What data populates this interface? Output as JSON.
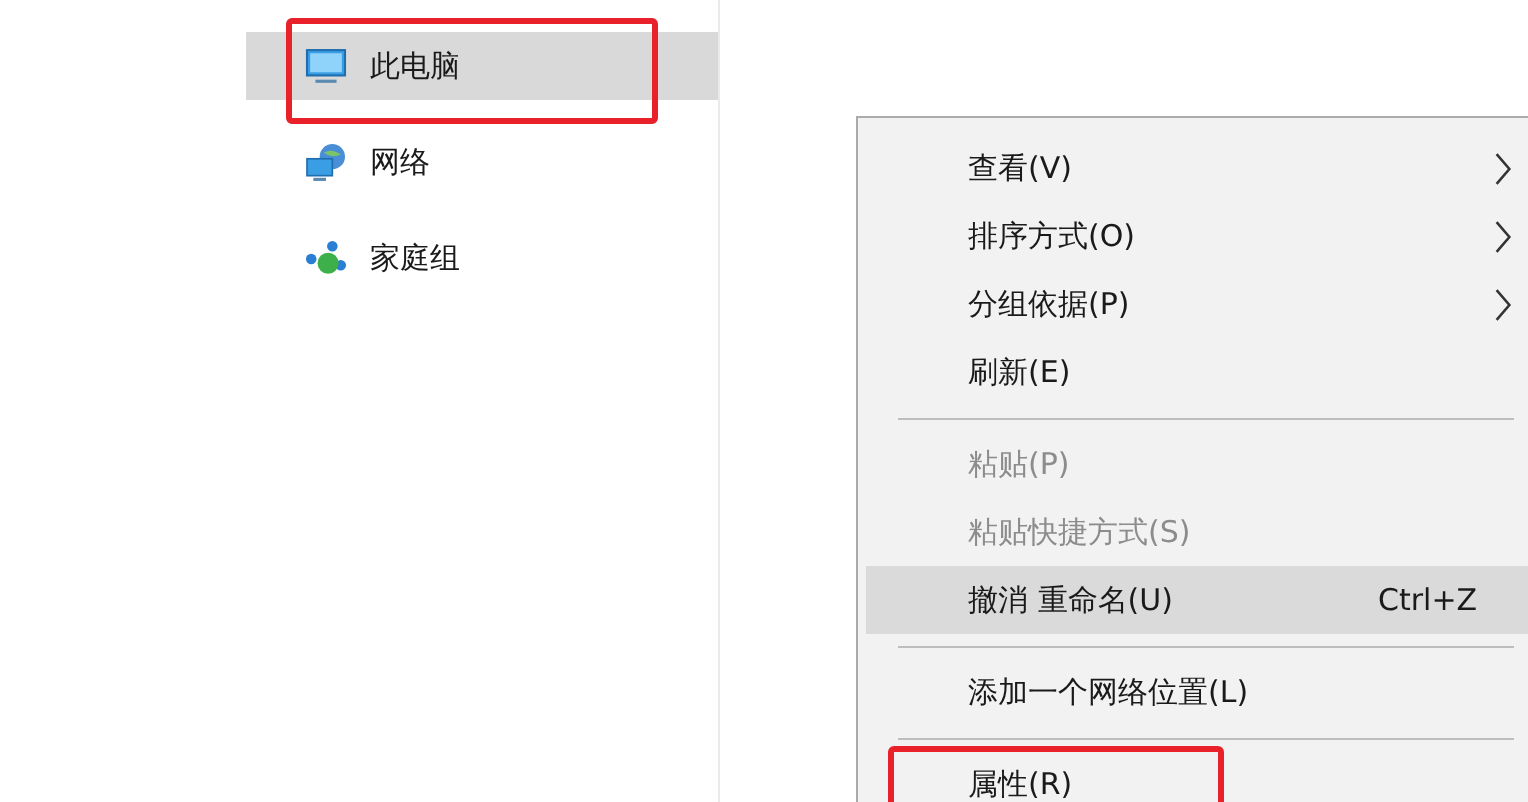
{
  "nav": {
    "items": [
      {
        "label": "此电脑",
        "selected": true,
        "annotated": true
      },
      {
        "label": "网络",
        "selected": false,
        "annotated": false
      },
      {
        "label": "家庭组",
        "selected": false,
        "annotated": false
      }
    ]
  },
  "context_menu": {
    "items": [
      {
        "kind": "item",
        "label": "查看(V)",
        "submenu": true,
        "disabled": false,
        "selected": false,
        "annotated": false
      },
      {
        "kind": "item",
        "label": "排序方式(O)",
        "submenu": true,
        "disabled": false,
        "selected": false,
        "annotated": false
      },
      {
        "kind": "item",
        "label": "分组依据(P)",
        "submenu": true,
        "disabled": false,
        "selected": false,
        "annotated": false
      },
      {
        "kind": "item",
        "label": "刷新(E)",
        "submenu": false,
        "disabled": false,
        "selected": false,
        "annotated": false
      },
      {
        "kind": "separator"
      },
      {
        "kind": "item",
        "label": "粘贴(P)",
        "submenu": false,
        "disabled": true,
        "selected": false,
        "annotated": false
      },
      {
        "kind": "item",
        "label": "粘贴快捷方式(S)",
        "submenu": false,
        "disabled": true,
        "selected": false,
        "annotated": false
      },
      {
        "kind": "item",
        "label": "撤消 重命名(U)",
        "shortcut": "Ctrl+Z",
        "submenu": false,
        "disabled": false,
        "selected": true,
        "annotated": false
      },
      {
        "kind": "separator"
      },
      {
        "kind": "item",
        "label": "添加一个网络位置(L)",
        "submenu": false,
        "disabled": false,
        "selected": false,
        "annotated": false
      },
      {
        "kind": "separator"
      },
      {
        "kind": "item",
        "label": "属性(R)",
        "submenu": false,
        "disabled": false,
        "selected": false,
        "annotated": true
      }
    ]
  }
}
